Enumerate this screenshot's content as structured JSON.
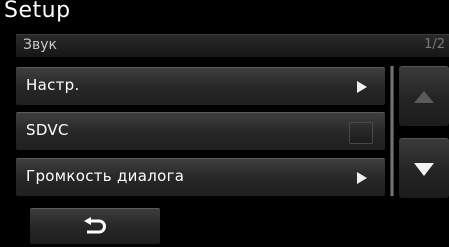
{
  "header": {
    "title": "Setup"
  },
  "subheader": {
    "section": "Звук",
    "page": "1/2"
  },
  "items": [
    {
      "label": "Настр.",
      "control": "arrow"
    },
    {
      "label": "SDVC",
      "control": "checkbox",
      "checked": false
    },
    {
      "label": "Громкость диалога",
      "control": "arrow"
    }
  ],
  "scroll": {
    "up_enabled": false,
    "down_enabled": true
  },
  "icons": {
    "back": "back-arrow-icon",
    "up": "scroll-up-icon",
    "down": "scroll-down-icon",
    "submenu": "chevron-right-icon"
  }
}
